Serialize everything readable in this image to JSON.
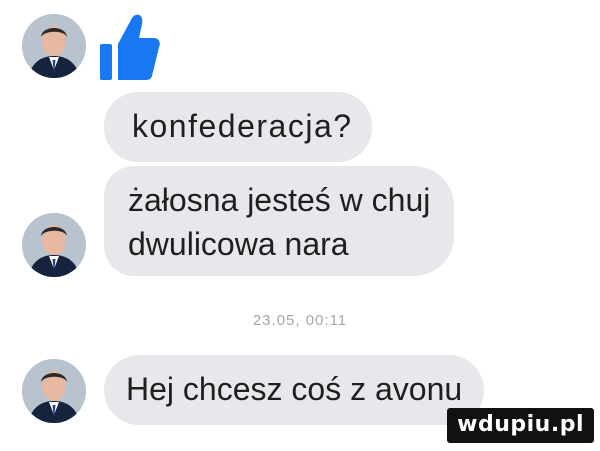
{
  "chat": {
    "messages": [
      {
        "lines": [
          "konfederacja?"
        ]
      },
      {
        "lines": [
          "żałosna jesteś w chuj",
          "dwulicowa nara"
        ]
      },
      {
        "lines": [
          "Hej chcesz coś z avonu"
        ]
      }
    ],
    "timestamp": "23.05, 00:11",
    "like_icon": "thumbs-up-icon"
  },
  "colors": {
    "bubble": "#e6e8eb",
    "text": "#1f1f1f",
    "timestamp": "#a2a7ae",
    "like": "#1877f2"
  },
  "watermark": {
    "text": "wdupiu.pl"
  }
}
